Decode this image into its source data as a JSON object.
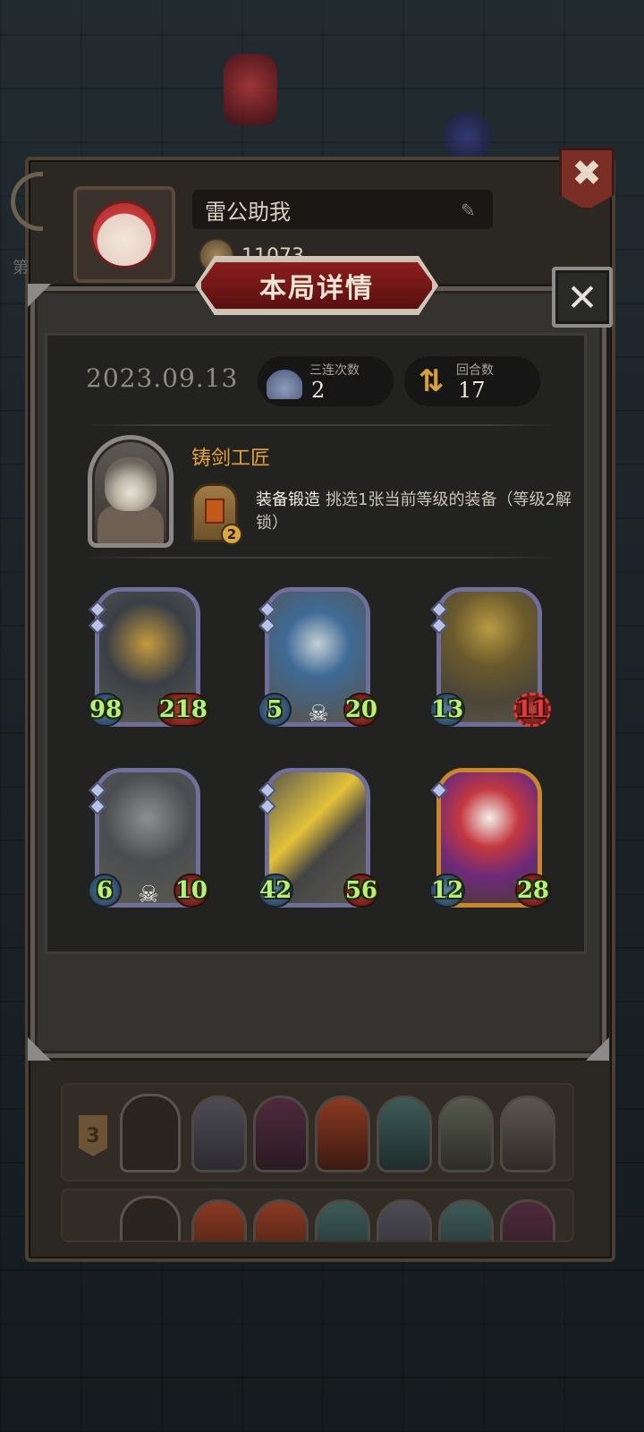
{
  "profile": {
    "player_name": "雷公助我",
    "coins": "11073",
    "side_label": "第",
    "close_icon": "close-icon"
  },
  "modal": {
    "title": "本局详情",
    "close_icon": "close-icon"
  },
  "match": {
    "date": "2023.09.13",
    "triple_label": "三连次数",
    "triple_value": "2",
    "round_label": "回合数",
    "round_value": "17"
  },
  "hero": {
    "name": "铸剑工匠",
    "skill_level": "2",
    "skill_name": "装备锻造",
    "skill_desc": "挑选1张当前等级的装备（等级2解锁）"
  },
  "units": [
    {
      "art": "robot",
      "atk": "98",
      "hp": "218",
      "gems": 2,
      "frame": "silver",
      "skull": false,
      "danger": false
    },
    {
      "art": "elf",
      "atk": "5",
      "hp": "20",
      "gems": 2,
      "frame": "silver",
      "skull": true,
      "danger": false
    },
    {
      "art": "witch",
      "atk": "13",
      "hp": "11",
      "gems": 2,
      "frame": "silver",
      "skull": false,
      "danger": true
    },
    {
      "art": "bell",
      "atk": "6",
      "hp": "10",
      "gems": 2,
      "frame": "silver",
      "skull": true,
      "danger": false
    },
    {
      "art": "bolt",
      "atk": "42",
      "hp": "56",
      "gems": 2,
      "frame": "silver",
      "skull": false,
      "danger": false
    },
    {
      "art": "clown",
      "atk": "12",
      "hp": "28",
      "gems": 1,
      "frame": "gold",
      "skull": false,
      "danger": false
    }
  ],
  "history": {
    "row1_rank": "3"
  },
  "colors": {
    "hero_name": "#e4a23a",
    "stat_green": "#b9f07a",
    "danger_red": "#e23a3a",
    "banner_red": "#8b1e1e"
  }
}
